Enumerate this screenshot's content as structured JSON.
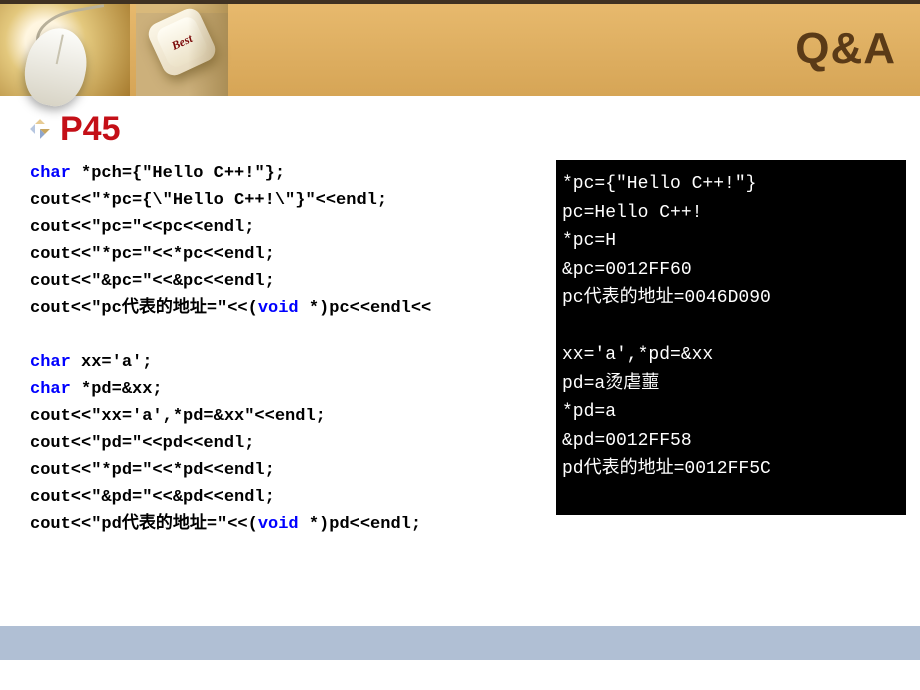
{
  "header": {
    "best_label": "Best",
    "title": "Q&A"
  },
  "bullet": {
    "label": "P45"
  },
  "code": {
    "kw_char_1": "char",
    "l1": " *pch={\"Hello C++!\"};",
    "l2": "cout<<\"*pc={\\\"Hello C++!\\\"}\"<<endl;",
    "l3": "cout<<\"pc=\"<<pc<<endl;",
    "l4": "cout<<\"*pc=\"<<*pc<<endl;",
    "l5": "cout<<\"&pc=\"<<&pc<<endl;",
    "l6a": "cout<<\"pc代表的地址=\"<<(",
    "kw_void_1": "void",
    "l6b": " *)pc<<endl<<",
    "blank": "",
    "kw_char_2": "char",
    "l7": " xx='a';",
    "kw_char_3": "char",
    "l8": " *pd=&xx;",
    "l9": "cout<<\"xx='a',*pd=&xx\"<<endl;",
    "l10": "cout<<\"pd=\"<<pd<<endl;",
    "l11": "cout<<\"*pd=\"<<*pd<<endl;",
    "l12": "cout<<\"&pd=\"<<&pd<<endl;",
    "l13a": "cout<<\"pd代表的地址=\"<<(",
    "kw_void_2": "void",
    "l13b": " *)pd<<endl;"
  },
  "console": {
    "l1": "*pc={\"Hello C++!\"}",
    "l2": "pc=Hello C++!",
    "l3": "*pc=H",
    "l4": "&pc=0012FF60",
    "l5": "pc代表的地址=0046D090",
    "blank": "",
    "l6": "xx='a',*pd=&xx",
    "l7": "pd=a烫虐蘁",
    "l8": "*pd=a",
    "l9": "&pd=0012FF58",
    "l10": "pd代表的地址=0012FF5C"
  }
}
